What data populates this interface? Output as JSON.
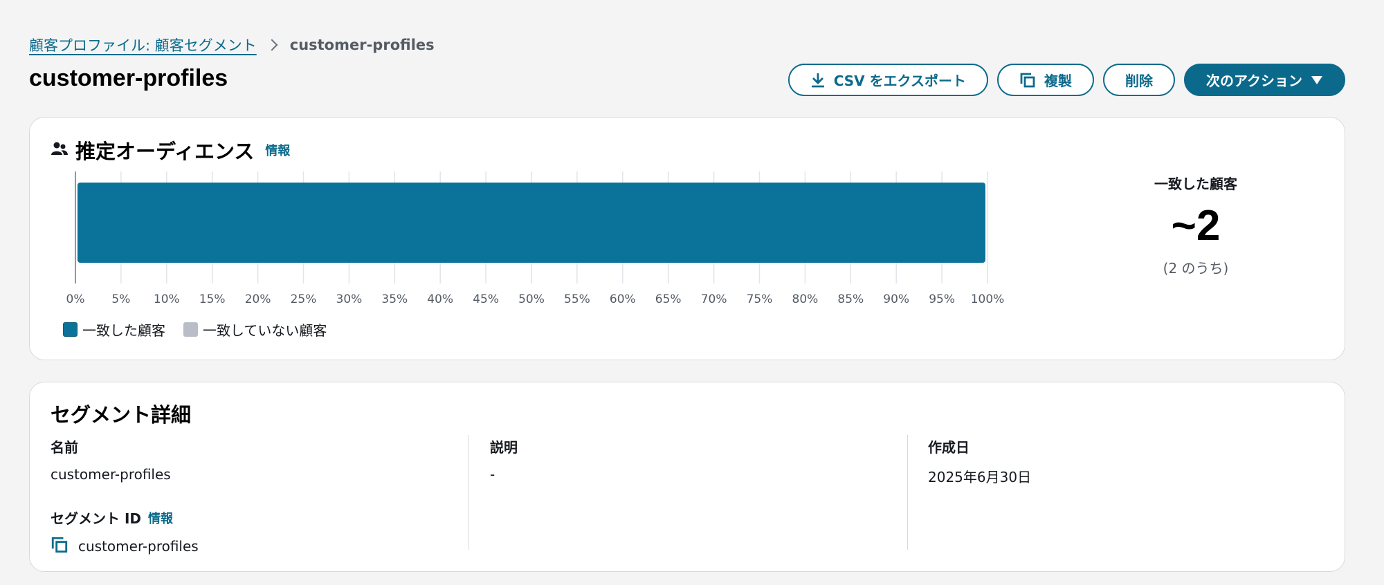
{
  "breadcrumb": {
    "parent": "顧客プロファイル: 顧客セグメント",
    "current": "customer-profiles"
  },
  "page_title": "customer-profiles",
  "actions": {
    "export_csv": "CSV をエクスポート",
    "duplicate": "複製",
    "delete": "削除",
    "next_action": "次のアクション"
  },
  "audience": {
    "title": "推定オーディエンス",
    "info": "情報",
    "matched_label": "一致した顧客",
    "matched_count": "~2",
    "matched_total": "(2 のうち)",
    "legend": {
      "matched": "一致した顧客",
      "unmatched": "一致していない顧客"
    }
  },
  "chart_data": {
    "type": "bar",
    "orientation": "horizontal",
    "stacked": true,
    "series": [
      {
        "name": "一致した顧客",
        "values": [
          100
        ],
        "color": "#0b7399"
      },
      {
        "name": "一致していない顧客",
        "values": [
          0
        ],
        "color": "#b8bdc8"
      }
    ],
    "xlim": [
      0,
      100
    ],
    "xticks": [
      "0%",
      "5%",
      "10%",
      "15%",
      "20%",
      "25%",
      "30%",
      "35%",
      "40%",
      "45%",
      "50%",
      "55%",
      "60%",
      "65%",
      "70%",
      "75%",
      "80%",
      "85%",
      "90%",
      "95%",
      "100%"
    ],
    "grid": true,
    "legend": "bottom-left"
  },
  "details": {
    "title": "セグメント詳細",
    "name_label": "名前",
    "name_value": "customer-profiles",
    "segment_id_label": "セグメント ID",
    "segment_id_info": "情報",
    "segment_id_value": "customer-profiles",
    "description_label": "説明",
    "description_value": "-",
    "created_label": "作成日",
    "created_value": "2025年6月30日"
  },
  "colors": {
    "accent": "#0b6a8c",
    "bar": "#0b7399",
    "unmatched": "#b8bdc8"
  }
}
